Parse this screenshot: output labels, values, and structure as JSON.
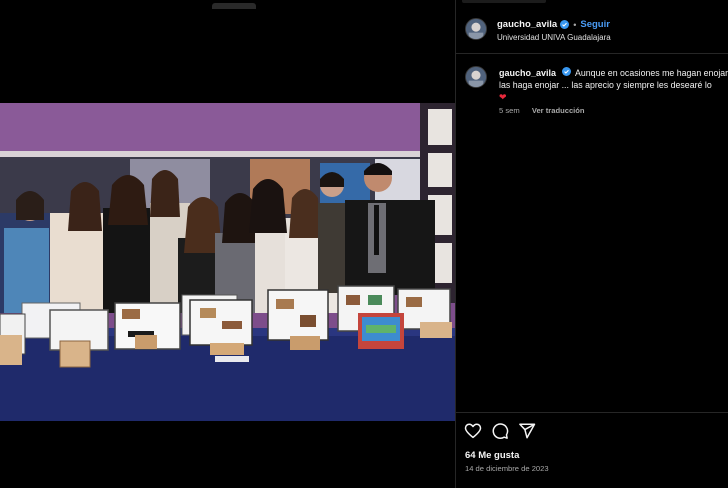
{
  "post": {
    "username": "gaucho_avila",
    "follow_label": "Seguir",
    "separator": "•",
    "location": "Universidad UNIVA Guadalajara"
  },
  "caption": {
    "username": "gaucho_avila",
    "line1": "Aunque en ocasiones me hagan enojar",
    "line2": "las haga enojar ... las aprecio y siempre les desearé lo",
    "emoji": "❤",
    "age": "5 sem",
    "translate_label": "Ver traducción"
  },
  "footer": {
    "likes": "64 Me gusta",
    "date": "14 de diciembre de 2023"
  },
  "icons": {
    "verified": "verified-badge-icon",
    "like": "heart-icon",
    "comment": "comment-bubble-icon",
    "share": "paper-plane-icon"
  },
  "colors": {
    "background": "#000000",
    "accent_link": "#4a9cf6",
    "verified": "#3897f0",
    "muted_text": "#a8a8a8",
    "divider": "#262626",
    "photo_wall": "#7e4f8c",
    "tablecloth": "#1f2a6b"
  }
}
